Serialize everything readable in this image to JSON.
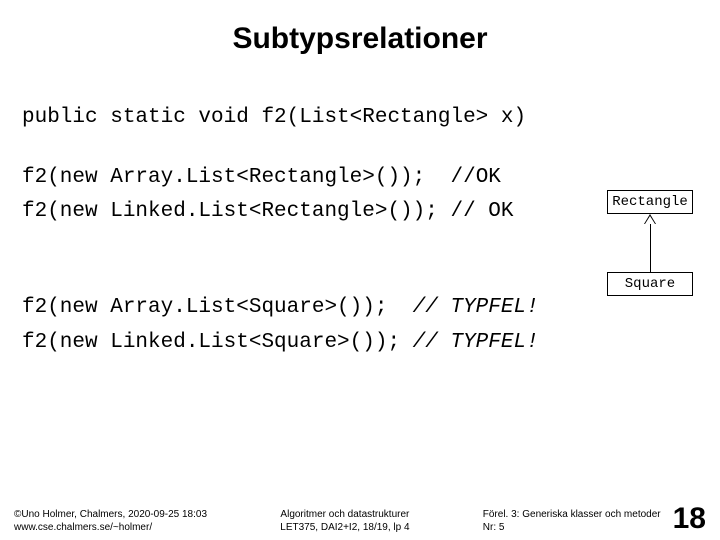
{
  "title": "Subtypsrelationer",
  "code": {
    "decl": "public static void f2(List<Rectangle> x)",
    "l1_pre": "f2(new Array.List<Rectangle>());  ",
    "l1_cmt": "//OK",
    "l2_pre": "f2(new Linked.List<Rectangle>()); ",
    "l2_cmt": "// OK",
    "l3_pre": "f2(new Array.List<Square>());  ",
    "l3_cmt": "// TYPFEL!",
    "l4_pre": "f2(new Linked.List<Square>()); ",
    "l4_cmt": "// TYPFEL!"
  },
  "diagram": {
    "top": "Rectangle",
    "bottom": "Square"
  },
  "footer": {
    "left_l1": "©Uno Holmer, Chalmers, 2020-09-25 18:03",
    "left_l2": "www.cse.chalmers.se/~holmer/",
    "center_l1": "Algoritmer och datastrukturer",
    "center_l2": "LET375, DAI2+I2, 18/19, lp 4",
    "right_l1": "Förel. 3: Generiska klasser och metoder",
    "right_l2": "Nr: 5",
    "page": "18"
  }
}
